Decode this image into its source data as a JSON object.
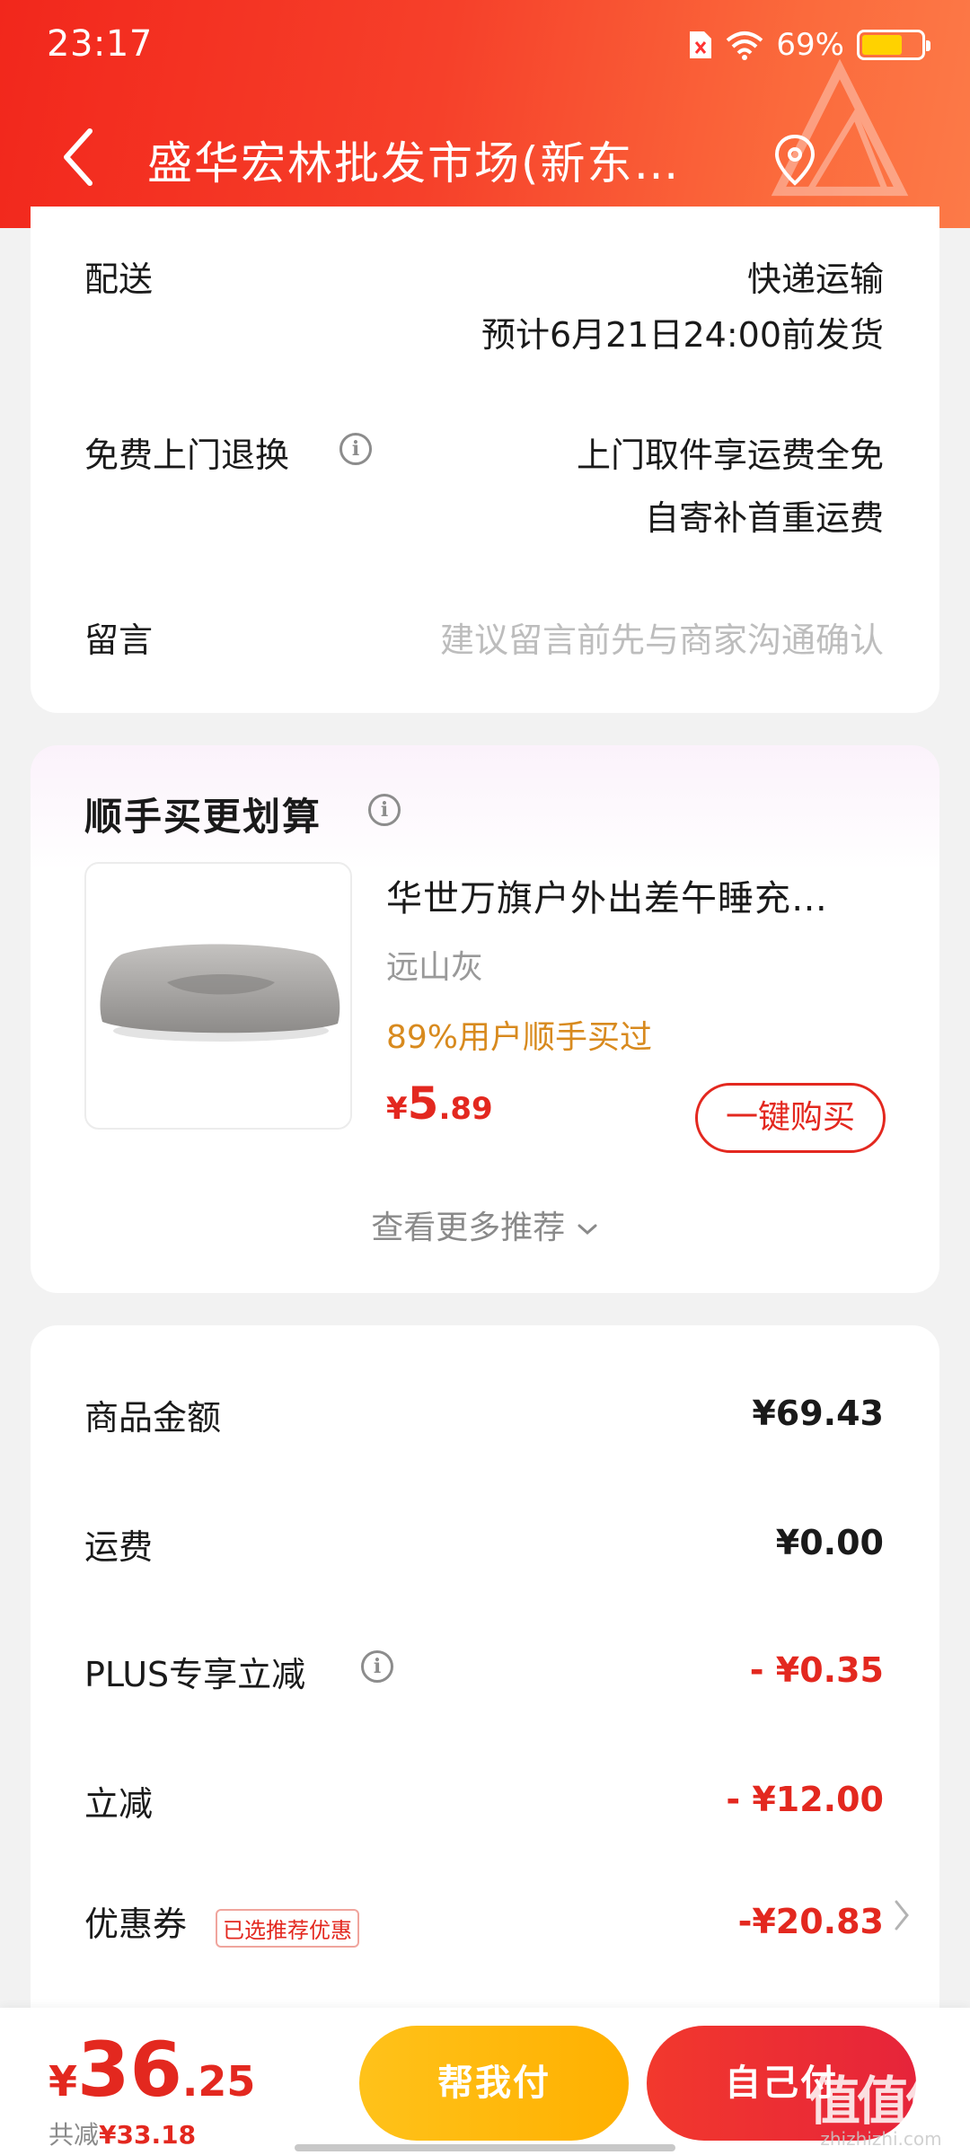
{
  "status": {
    "time": "23:17",
    "battery_pct": "69%",
    "battery_level": 0.69
  },
  "nav": {
    "title": "盛华宏林批发市场(新东…"
  },
  "delivery": {
    "shipping_label": "配送",
    "shipping_method": "快递运输",
    "shipping_eta": "预计6月21日24:00前发货",
    "return_label": "免费上门退换",
    "return_line1": "上门取件享运费全免",
    "return_line2": "自寄补首重运费",
    "note_label": "留言",
    "note_placeholder": "建议留言前先与商家沟通确认"
  },
  "addon": {
    "title": "顺手买更划算",
    "product_name": "华世万旗户外出差午睡充…",
    "variant": "远山灰",
    "social_proof": "89%用户顺手买过",
    "price_symbol": "¥",
    "price_int": "5",
    "price_dec": ".89",
    "buy_label": "一键购买",
    "see_more": "查看更多推荐"
  },
  "summary": {
    "goods_label": "商品金额",
    "goods_value": "¥69.43",
    "freight_label": "运费",
    "freight_value": "¥0.00",
    "plus_label": "PLUS专享立减",
    "plus_value": "- ¥0.35",
    "discount_label": "立减",
    "discount_value": "- ¥12.00",
    "coupon_label": "优惠券",
    "coupon_tag": "已选推荐优惠",
    "coupon_value": "-¥20.83"
  },
  "footer": {
    "total_symbol": "¥",
    "total_int": "36",
    "total_dec": ".25",
    "saved_label": "共减",
    "saved_value": "¥33.18",
    "help_pay_label": "帮我付",
    "self_pay_label": "自己付"
  },
  "watermark": {
    "text": "值值值",
    "site": "zhizhizhi.com"
  },
  "colors": {
    "accent_red": "#e3281f",
    "header_red": "#f2271c",
    "gold": "#ffb800",
    "social_orange": "#d88a1e"
  }
}
